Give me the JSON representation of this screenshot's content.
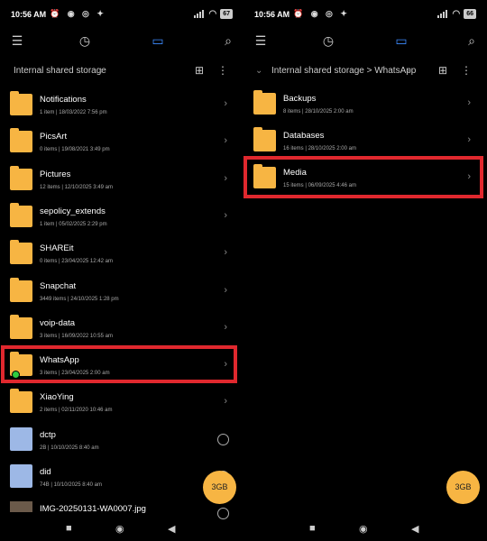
{
  "status_bar": {
    "time": "10:56 AM",
    "battery_left": "67",
    "battery_right": "66"
  },
  "left": {
    "breadcrumb": "Internal shared storage",
    "items": [
      {
        "name": "Notifications",
        "meta": "1 item  |  18/03/2022 7:56 pm",
        "kind": "folder"
      },
      {
        "name": "PicsArt",
        "meta": "0 items  |  19/08/2021 3:49 pm",
        "kind": "folder"
      },
      {
        "name": "Pictures",
        "meta": "12 items  |  12/10/2025 3:49 am",
        "kind": "folder"
      },
      {
        "name": "sepolicy_extends",
        "meta": "1 item  |  05/02/2025 2:29 pm",
        "kind": "folder"
      },
      {
        "name": "SHAREit",
        "meta": "0 items  |  23/04/2025 12:42 am",
        "kind": "folder"
      },
      {
        "name": "Snapchat",
        "meta": "3449 items  |  24/10/2025 1:28 pm",
        "kind": "folder"
      },
      {
        "name": "voip-data",
        "meta": "3 items  |  16/09/2022 10:55 am",
        "kind": "folder"
      },
      {
        "name": "WhatsApp",
        "meta": "3 items  |  23/04/2025 2:00 am",
        "kind": "folder"
      },
      {
        "name": "XiaoYing",
        "meta": "2 items  |  02/11/2020 10:46 am",
        "kind": "folder"
      },
      {
        "name": "dctp",
        "meta": "2B  |  10/10/2025 8:40 am",
        "kind": "file"
      },
      {
        "name": "did",
        "meta": "74B  |  10/10/2025 8:40 am",
        "kind": "file"
      },
      {
        "name": "IMG-20250131-WA0007.jpg",
        "meta": "",
        "kind": "image"
      }
    ],
    "fab": "3GB"
  },
  "right": {
    "breadcrumb": "Internal shared storage  >  WhatsApp",
    "items": [
      {
        "name": "Backups",
        "meta": "8 items  |  28/10/2025 2:00 am",
        "kind": "folder"
      },
      {
        "name": "Databases",
        "meta": "16 items  |  28/10/2025 2:00 am",
        "kind": "folder"
      },
      {
        "name": "Media",
        "meta": "15 items  |  06/09/2025 4:46 am",
        "kind": "folder"
      }
    ],
    "fab": "3GB"
  },
  "colors": {
    "folder": "#f7b543",
    "highlight": "#e0282e",
    "accent": "#3d8bff"
  }
}
